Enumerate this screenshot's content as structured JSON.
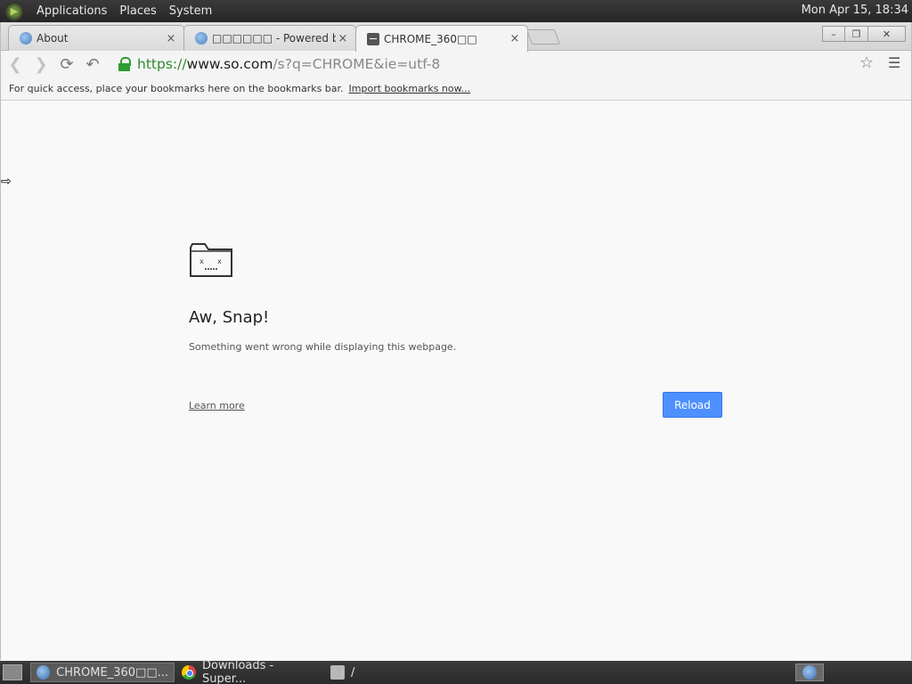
{
  "top_panel": {
    "menus": [
      "Applications",
      "Places",
      "System"
    ],
    "clock": "Mon Apr 15, 18:34"
  },
  "tabs": [
    {
      "title": "About",
      "icon": "globe-icon",
      "active": false
    },
    {
      "title": "□□□□□□ - Powered by",
      "icon": "globe-icon",
      "active": false
    },
    {
      "title": "CHROME_360□□",
      "icon": "sad-tab-icon",
      "active": true
    }
  ],
  "tab_close_glyph": "×",
  "toolbar": {
    "url_scheme": "https://",
    "url_host": "www.so.com",
    "url_path": "/s?q=CHROME&ie=utf-8"
  },
  "bookmarks_bar": {
    "message": "For quick access, place your bookmarks here on the bookmarks bar.",
    "import_link": "Import bookmarks now..."
  },
  "error_page": {
    "title": "Aw, Snap!",
    "message": "Something went wrong while displaying this webpage.",
    "learn_more": "Learn more",
    "reload": "Reload"
  },
  "taskbar": {
    "items": [
      {
        "label": "CHROME_360□□...",
        "icon": "globe-icon",
        "active": true
      },
      {
        "label": "Downloads - Super...",
        "icon": "chrome-icon",
        "active": false
      },
      {
        "label": "/",
        "icon": "folder-icon",
        "active": false
      }
    ]
  },
  "colors": {
    "reload_button": "#4d90fe",
    "url_scheme": "#2e8b2e",
    "lock": "#2e9b33"
  }
}
